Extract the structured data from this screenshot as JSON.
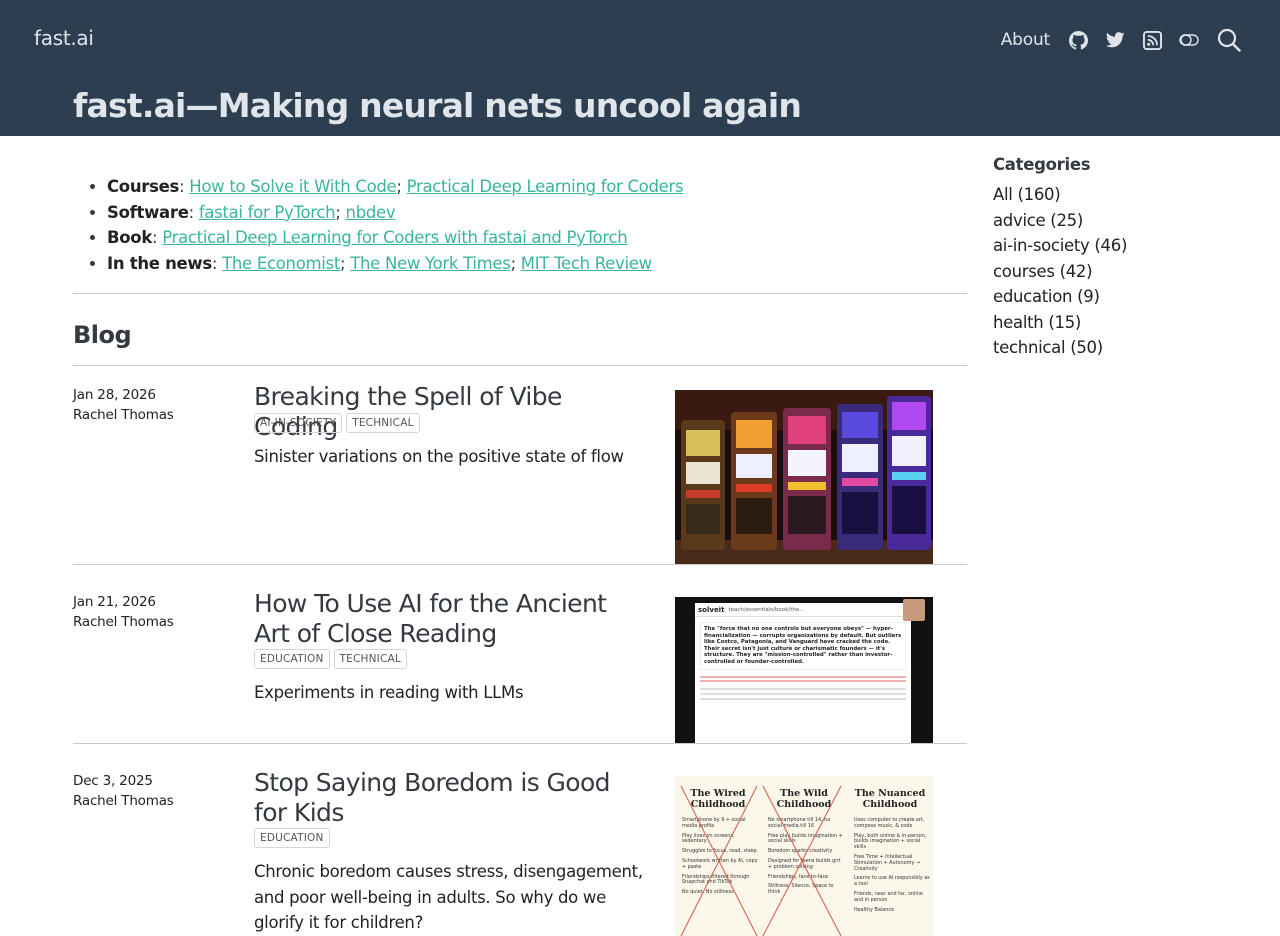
{
  "header": {
    "brand": "fast.ai",
    "about": "About",
    "icons": [
      "github-icon",
      "twitter-icon",
      "rss-icon",
      "toggle-icon",
      "search-icon"
    ],
    "site_title": "fast.ai—Making neural nets uncool again"
  },
  "intro": {
    "courses_label": "Courses",
    "courses": [
      "How to Solve it With Code",
      "Practical Deep Learning for Coders"
    ],
    "software_label": "Software",
    "software": [
      "fastai for PyTorch",
      "nbdev"
    ],
    "book_label": "Book",
    "book": [
      "Practical Deep Learning for Coders with fastai and PyTorch"
    ],
    "news_label": "In the news",
    "news": [
      "The Economist",
      "The New York Times",
      "MIT Tech Review"
    ]
  },
  "blog": {
    "heading": "Blog",
    "posts": [
      {
        "date": "Jan 28, 2026",
        "author": "Rachel Thomas",
        "title": "Breaking the Spell of Vibe Coding",
        "tags": [
          "AI-IN-SOCIETY",
          "TECHNICAL"
        ],
        "description": "Sinister variations on the positive state of flow"
      },
      {
        "date": "Jan 21, 2026",
        "author": "Rachel Thomas",
        "title": "How To Use AI for the Ancient Art of Close Reading",
        "tags": [
          "EDUCATION",
          "TECHNICAL"
        ],
        "description": "Experiments in reading with LLMs",
        "thumb": {
          "app": "solveit",
          "doc_path": "teach/essentials/book/the...",
          "quote": "The \"force that no one controls but everyone obeys\" — hyper-financialization — corrupts organizations by default. But outliers like Costco, Patagonia, and Vanguard have cracked the code. Their secret isn't just culture or charismatic founders — it's structure. They are \"mission-controlled\" rather than investor-controlled or founder-controlled."
        }
      },
      {
        "date": "Dec 3, 2025",
        "author": "Rachel Thomas",
        "title": "Stop Saying Boredom is Good for Kids",
        "tags": [
          "EDUCATION"
        ],
        "description": "Chronic boredom causes stress, disengagement, and poor well-being in adults. So why do we glorify it for children?",
        "thumb": {
          "columns": [
            {
              "heading": "The Wired Childhood",
              "items": [
                "Smartphone by 9 + social media profile",
                "Play lives on screens, sedentary",
                "Struggles to focus, read, sleep",
                "Schoolwork written by AI, copy + paste",
                "Friendships filtered through Snapchat and TikTok",
                "No quiet. No stillness"
              ]
            },
            {
              "heading": "The Wild Childhood",
              "items": [
                "No smartphone till 14, no social media till 16",
                "Free play builds imagination + social skills",
                "Boredom sparks creativity",
                "Designed for teens builds grit + problem solving",
                "Friendships, face-to-face",
                "Stillness, Silence, Space to think"
              ]
            },
            {
              "heading": "The Nuanced Childhood",
              "items": [
                "Uses computer to create art, compose music, & code",
                "Play, both online & in-person, builds imagination + social skills",
                "Free Time + Intellectual Stimulation + Autonomy → Creativity",
                "Learns to use AI responsibly as a tool",
                "Friends, near and far, online and in person",
                "Healthy Balance"
              ]
            }
          ]
        }
      }
    ]
  },
  "sidebar": {
    "heading": "Categories",
    "items": [
      "All (160)",
      "advice (25)",
      "ai-in-society (46)",
      "courses (42)",
      "education (9)",
      "health (15)",
      "technical (50)"
    ]
  },
  "colors": {
    "navbar": "#2d3e50",
    "link": "#39b59d",
    "nav_text": "#dfe5ea"
  }
}
